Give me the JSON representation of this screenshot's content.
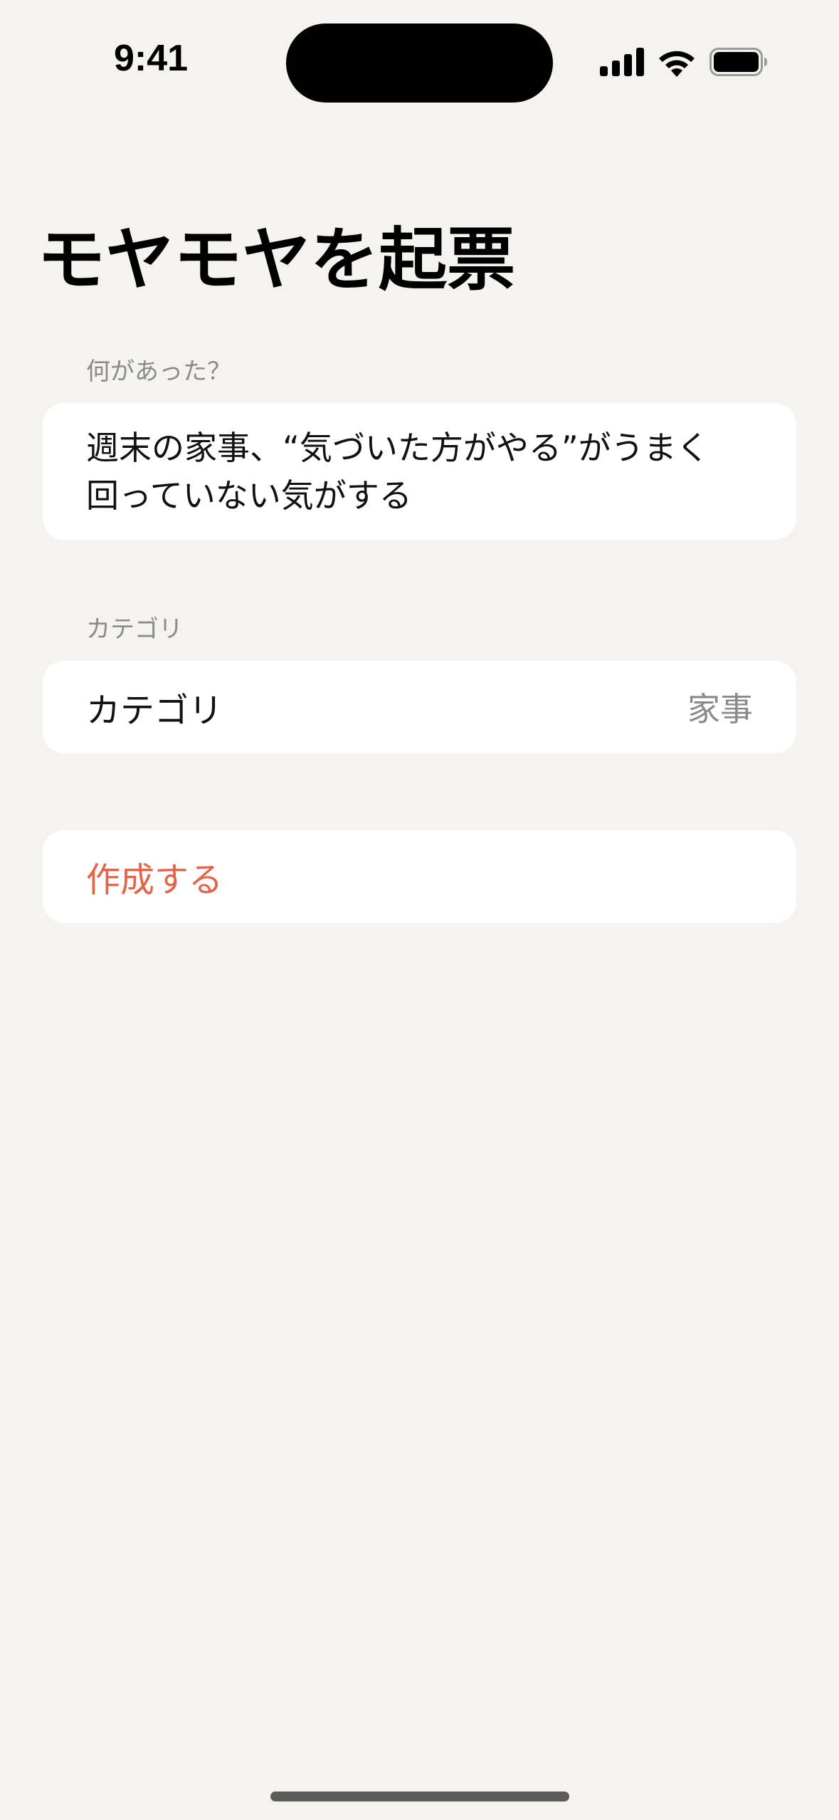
{
  "status_bar": {
    "time": "9:41",
    "icons": [
      "cellular-signal-icon",
      "wifi-icon",
      "battery-icon"
    ]
  },
  "page": {
    "title": "モヤモヤを起票"
  },
  "form": {
    "what_label": "何があった？",
    "what_value": "週末の家事、“気づいた方がやる”がうまく\n回っていない気がする",
    "category_section_label": "カテゴリ",
    "category_row_label": "カテゴリ",
    "category_value": "家事",
    "create_label": "作成する"
  },
  "colors": {
    "background": "#f4f3f0",
    "card": "#ffffff",
    "accent": "#e0654a",
    "secondary_text": "#8a8a8a"
  }
}
